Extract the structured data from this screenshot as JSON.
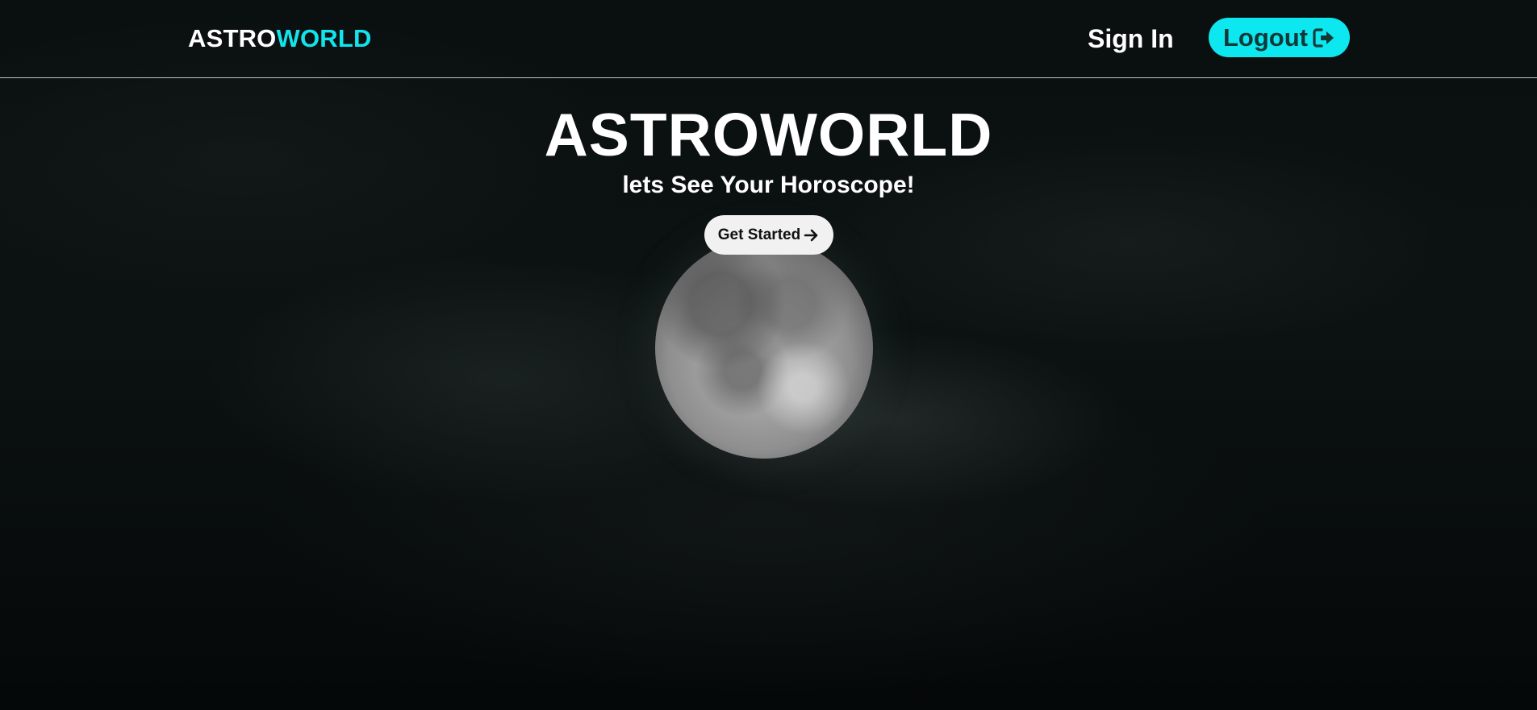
{
  "header": {
    "brand_part1": "ASTRO",
    "brand_part2": "WORLD",
    "signin_label": "Sign In",
    "logout_label": "Logout",
    "logout_icon": "sign-out-icon"
  },
  "hero": {
    "title": "ASTROWORLD",
    "subtitle": "lets See Your Horoscope!",
    "cta_label": "Get Started",
    "cta_icon": "arrow-right-icon",
    "image": "moon-image"
  },
  "colors": {
    "accent": "#0de7ef",
    "background": "#0a0f0f",
    "text": "#ffffff",
    "cta_bg": "#f1f1f1"
  }
}
